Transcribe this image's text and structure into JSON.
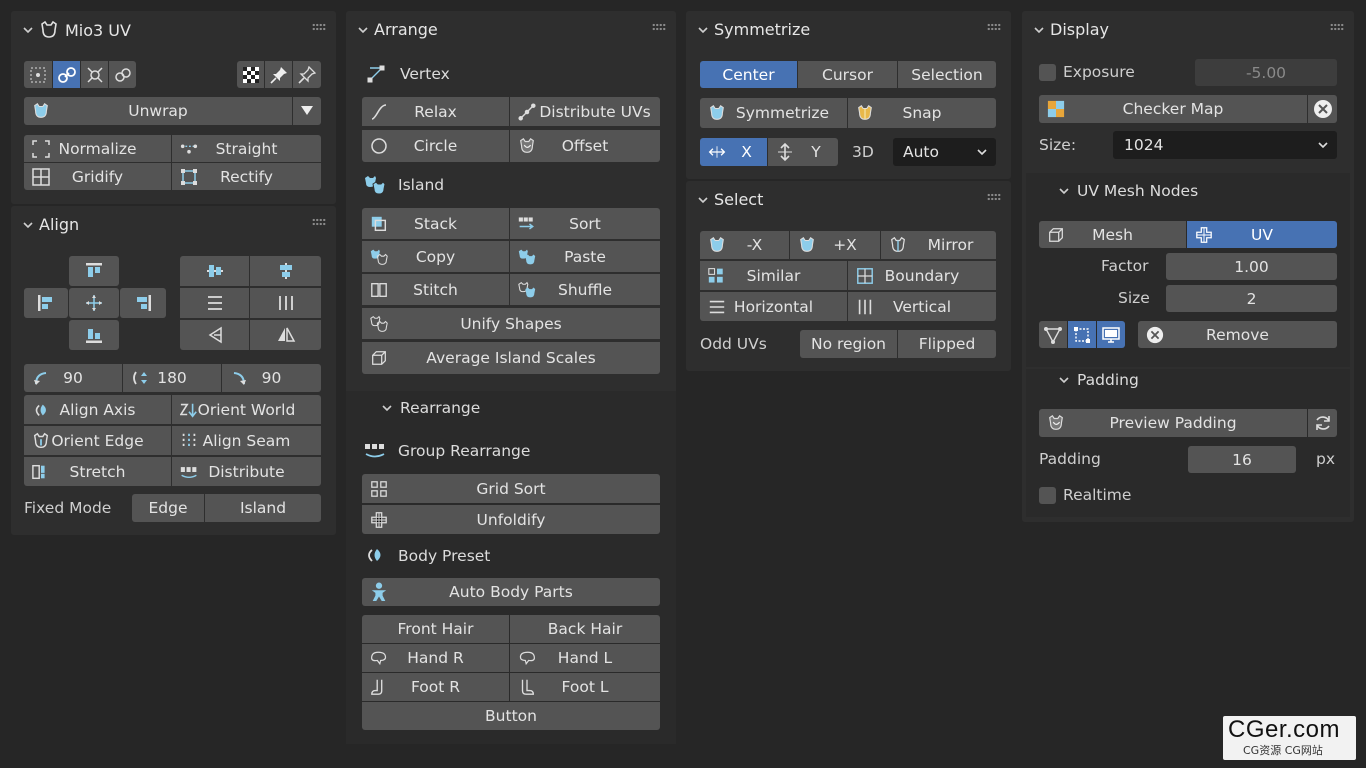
{
  "mio3": {
    "title": "Mio3 UV",
    "unwrap": "Unwrap",
    "normalize": "Normalize",
    "straight": "Straight",
    "gridify": "Gridify",
    "rectify": "Rectify"
  },
  "align": {
    "title": "Align",
    "rot_left": "90",
    "rot_mid": "180",
    "rot_right": "90",
    "align_axis": "Align Axis",
    "orient_world": "Orient World",
    "orient_edge": "Orient Edge",
    "align_seam": "Align Seam",
    "stretch": "Stretch",
    "distribute": "Distribute",
    "fixed_mode": "Fixed Mode",
    "edge": "Edge",
    "island": "Island"
  },
  "arrange": {
    "title": "Arrange",
    "vertex": "Vertex",
    "relax": "Relax",
    "distribute_uvs": "Distribute UVs",
    "circle": "Circle",
    "offset": "Offset",
    "island": "Island",
    "stack": "Stack",
    "sort": "Sort",
    "copy": "Copy",
    "paste": "Paste",
    "stitch": "Stitch",
    "shuffle": "Shuffle",
    "unify_shapes": "Unify Shapes",
    "average_scales": "Average Island Scales",
    "rearrange": "Rearrange",
    "group_rearrange": "Group Rearrange",
    "grid_sort": "Grid Sort",
    "unfoldify": "Unfoldify",
    "body_preset": "Body Preset",
    "auto_body_parts": "Auto Body Parts",
    "front_hair": "Front Hair",
    "back_hair": "Back Hair",
    "hand_r": "Hand R",
    "hand_l": "Hand L",
    "foot_r": "Foot R",
    "foot_l": "Foot L",
    "button": "Button"
  },
  "symmetrize": {
    "title": "Symmetrize",
    "center": "Center",
    "cursor": "Cursor",
    "selection": "Selection",
    "symmetrize": "Symmetrize",
    "snap": "Snap",
    "x": "X",
    "y": "Y",
    "three_d": "3D",
    "auto": "Auto"
  },
  "select": {
    "title": "Select",
    "neg_x": "-X",
    "pos_x": "+X",
    "mirror": "Mirror",
    "similar": "Similar",
    "boundary": "Boundary",
    "horizontal": "Horizontal",
    "vertical": "Vertical",
    "odd_uvs": "Odd UVs",
    "no_region": "No region",
    "flipped": "Flipped"
  },
  "display": {
    "title": "Display",
    "exposure": "Exposure",
    "exposure_value": "-5.00",
    "checker_map": "Checker Map",
    "size_label": "Size:",
    "size_value": "1024",
    "uv_mesh_nodes": "UV Mesh Nodes",
    "mesh": "Mesh",
    "uv": "UV",
    "factor": "Factor",
    "factor_value": "1.00",
    "size": "Size",
    "size_n": "2",
    "remove": "Remove",
    "padding_section": "Padding",
    "preview_padding": "Preview Padding",
    "padding": "Padding",
    "padding_value": "16",
    "px": "px",
    "realtime": "Realtime"
  },
  "watermark": {
    "brand": "CGer.com",
    "sub": "CG资源 CG网站"
  },
  "colors": {
    "accent": "#4772b3",
    "icon_blue": "#8dcdea",
    "panel": "#2e2e2e",
    "button": "#545454"
  }
}
